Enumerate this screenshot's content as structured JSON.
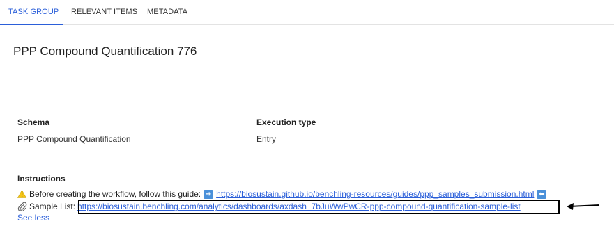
{
  "tabs": [
    {
      "label": "TASK GROUP",
      "active": true
    },
    {
      "label": "RELEVANT ITEMS",
      "active": false
    },
    {
      "label": "METADATA",
      "active": false
    }
  ],
  "title": "PPP Compound Quantification 776",
  "fields": {
    "schema": {
      "label": "Schema",
      "value": "PPP Compound Quantification"
    },
    "execution_type": {
      "label": "Execution type",
      "value": "Entry"
    }
  },
  "instructions": {
    "label": "Instructions",
    "line1_text": "Before creating the workflow, follow this guide:",
    "line1_link": "https://biosustain.github.io/benchling-resources/guides/ppp_samples_submission.html",
    "line2_text": "Sample List:",
    "line2_link": "https://biosustain.benchling.com/analytics/dashboards/axdash_7bJuWwPwCR-ppp-compound-quantification-sample-list",
    "see_less": "See less"
  },
  "colors": {
    "accent": "#2b5fd9",
    "warning": "#f5c518",
    "icon_box": "#4a90d9"
  },
  "icons": [
    "warning-icon",
    "arrow-right-icon",
    "arrow-left-icon",
    "paperclip-icon",
    "callout-arrow-icon"
  ]
}
